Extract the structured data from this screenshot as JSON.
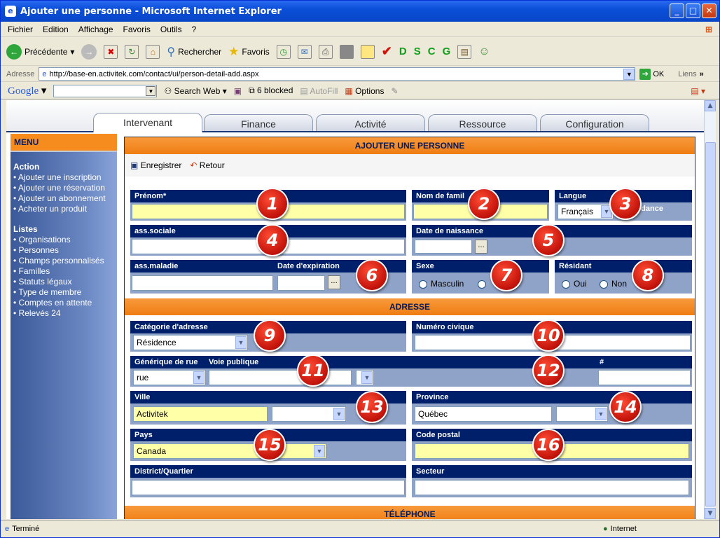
{
  "window": {
    "title": "Ajouter une personne - Microsoft Internet Explorer"
  },
  "menubar": [
    "Fichier",
    "Edition",
    "Affichage",
    "Favoris",
    "Outils",
    "?"
  ],
  "toolbar": {
    "back": "Précédente",
    "search": "Rechercher",
    "favorites": "Favoris",
    "letters": [
      "D",
      "S",
      "C",
      "G"
    ]
  },
  "address": {
    "label": "Adresse",
    "url": "http://base-en.activitek.com/contact/ui/person-detail-add.aspx",
    "go": "OK",
    "links": "Liens"
  },
  "googlebar": {
    "logo": "Google",
    "search_web": "Search Web",
    "blocked": "6 blocked",
    "autofill": "AutoFill",
    "options": "Options"
  },
  "tabs": [
    "Intervenant",
    "Finance",
    "Activité",
    "Ressource",
    "Configuration"
  ],
  "sidebar": {
    "menu_title": "MENU",
    "action_title": "Action",
    "action_items": [
      "• Ajouter une inscription",
      "• Ajouter une réservation",
      "• Ajouter un abonnement",
      "• Acheter un produit"
    ],
    "lists_title": "Listes",
    "lists_items": [
      "• Organisations",
      "• Personnes",
      "• Champs personnalisés",
      "• Familles",
      "• Statuts légaux",
      "• Type de membre",
      "• Comptes en attente",
      "• Relevés 24"
    ]
  },
  "form": {
    "title": "AJOUTER UNE PERSONNE",
    "save": "Enregistrer",
    "back": "Retour",
    "prenom": "Prénom*",
    "nom": "Nom de famil",
    "langue": "Langue pour",
    "langue_tail": "ndance",
    "langue_value": "Français",
    "ass_sociale": "ass.sociale",
    "date_naissance": "Date de naissance",
    "ass_maladie": "ass.maladie",
    "date_expiration": "Date d'expiration",
    "sexe": "Sexe",
    "masculin": "Masculin",
    "resident": "Résidant",
    "oui": "Oui",
    "non": "Non"
  },
  "address_section": {
    "title": "ADRESSE",
    "categorie": "Catégorie d'adresse",
    "categorie_value": "Résidence",
    "numero": "Numéro civique",
    "generique": "Générique de rue",
    "generique_value": "rue",
    "voie": "Voie publique",
    "hash": "#",
    "ville": "Ville",
    "ville_value": "Activitek",
    "province": "Province",
    "province_value": "Québec",
    "pays": "Pays",
    "pays_value": "Canada",
    "code_postal": "Code postal",
    "district": "District/Quartier",
    "secteur": "Secteur"
  },
  "phone_section": {
    "title": "TÉLÉPHONE"
  },
  "badges": [
    "1",
    "2",
    "3",
    "4",
    "5",
    "6",
    "7",
    "8",
    "9",
    "10",
    "11",
    "12",
    "13",
    "14",
    "15",
    "16"
  ],
  "status": {
    "left": "Terminé",
    "zone": "Internet"
  },
  "colors": {
    "accent_orange": "#f68b1e",
    "label_navy": "#001f6b",
    "field_yellow": "#ffffa8",
    "badge_red": "#d0150b"
  }
}
